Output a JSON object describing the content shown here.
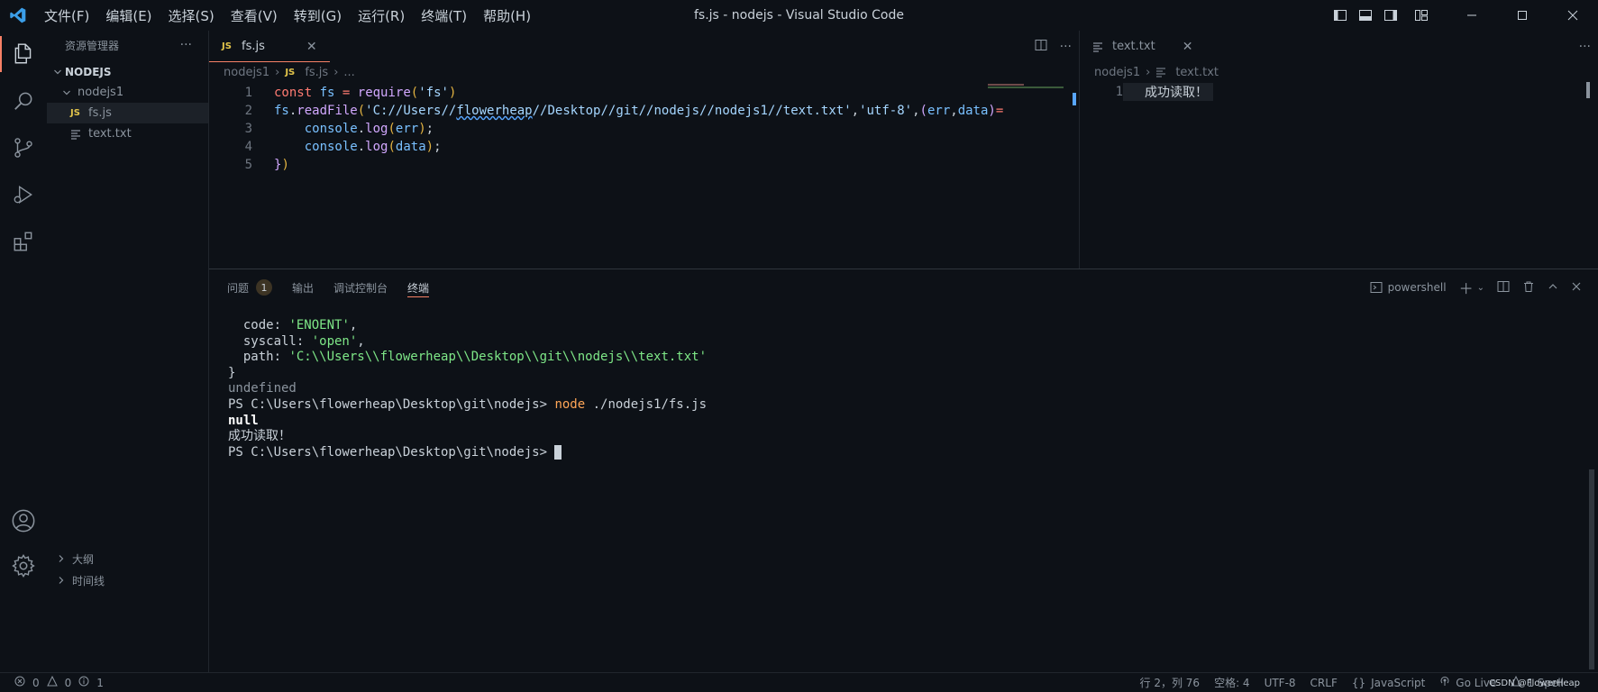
{
  "window": {
    "title": "fs.js - nodejs - Visual Studio Code"
  },
  "menu": [
    "文件(F)",
    "编辑(E)",
    "选择(S)",
    "查看(V)",
    "转到(G)",
    "运行(R)",
    "终端(T)",
    "帮助(H)"
  ],
  "sidebar": {
    "title": "资源管理器",
    "root": "NODEJS",
    "folder": "nodejs1",
    "files": [
      "fs.js",
      "text.txt"
    ],
    "outline": "大纲",
    "timeline": "时间线"
  },
  "editor1": {
    "tab": "fs.js",
    "tab_badge": "JS",
    "breadcrumb": [
      "nodejs1",
      "fs.js",
      "..."
    ],
    "lines": [
      "const fs = require('fs')",
      "fs.readFile('C://Users//flowerheap//Desktop//git//nodejs//nodejs1//text.txt','utf-8',(err,data)=",
      "    console.log(err);",
      "    console.log(data);",
      "})"
    ],
    "line_numbers": [
      "1",
      "2",
      "3",
      "4",
      "5"
    ]
  },
  "editor2": {
    "tab": "text.txt",
    "breadcrumb": [
      "nodejs1",
      "text.txt"
    ],
    "line_numbers": [
      "1"
    ],
    "lines": [
      "成功读取！"
    ]
  },
  "panel": {
    "tabs": [
      "问题",
      "输出",
      "调试控制台",
      "终端"
    ],
    "problems_count": "1",
    "terminal_shell": "powershell",
    "terminal": [
      "  code: 'ENOENT',",
      "  syscall: 'open',",
      "  path: 'C:\\\\Users\\\\flowerheap\\\\Desktop\\\\git\\\\nodejs\\\\text.txt'",
      "}",
      "undefined",
      "PS C:\\Users\\flowerheap\\Desktop\\git\\nodejs> ",
      "null",
      "成功读取！",
      "PS C:\\Users\\flowerheap\\Desktop\\git\\nodejs> "
    ],
    "terminal_keys": {
      "code_key": "  code: ",
      "code_val": "'ENOENT'",
      "syscall_key": "  syscall: ",
      "syscall_val": "'open'",
      "path_key": "  path: ",
      "path_val": "'C:\\\\Users\\\\flowerheap\\\\Desktop\\\\git\\\\nodejs\\\\text.txt'",
      "cmd_node": "node",
      "cmd_arg": " ./nodejs1/fs.js"
    }
  },
  "statusbar": {
    "errors": "0",
    "warnings": "0",
    "infos": "1",
    "position": "行 2，列 76",
    "spaces": "空格: 4",
    "encoding": "UTF-8",
    "eol": "CRLF",
    "language": "JavaScript",
    "golive": "Go Live",
    "spell": "1 Spell"
  },
  "watermark": "CSDN @FlowerHeap",
  "colors": {
    "accent": "#f78166",
    "background": "#0d1117",
    "keyword": "#ff7b72",
    "function": "#d2a8ff",
    "string": "#a5d6ff",
    "terminal_string": "#7ee787",
    "command": "#ffa657"
  }
}
